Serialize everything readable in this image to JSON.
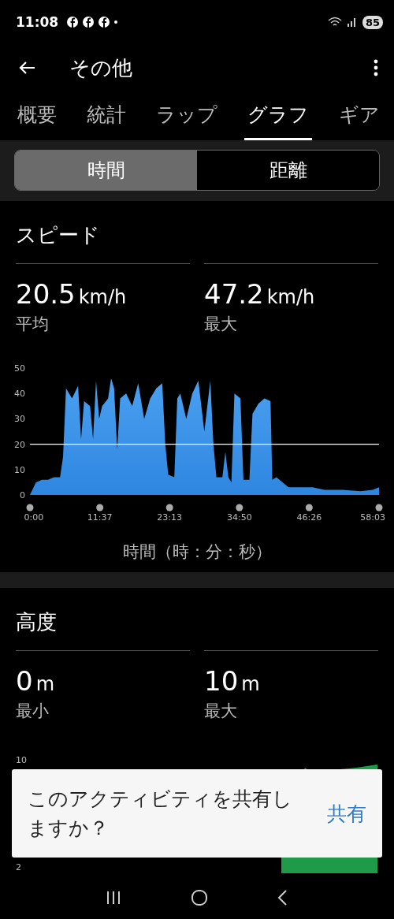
{
  "status_bar": {
    "time": "11:08",
    "battery": "85"
  },
  "app_bar": {
    "title": "その他"
  },
  "tabs": [
    {
      "label": "概要",
      "selected": false
    },
    {
      "label": "統計",
      "selected": false
    },
    {
      "label": "ラップ",
      "selected": false
    },
    {
      "label": "グラフ",
      "selected": true
    },
    {
      "label": "ギア",
      "selected": false
    }
  ],
  "segments": [
    {
      "label": "時間",
      "selected": true
    },
    {
      "label": "距離",
      "selected": false
    }
  ],
  "speed": {
    "title": "スピード",
    "stats": [
      {
        "value": "20.5",
        "unit": "km/h",
        "label": "平均"
      },
      {
        "value": "47.2",
        "unit": "km/h",
        "label": "最大"
      }
    ],
    "chart_data": {
      "type": "area",
      "xlabel": "時間（時：分：秒）",
      "ylim": [
        0,
        50
      ],
      "yticks": [
        0,
        10,
        20,
        30,
        40,
        50
      ],
      "xlim": [
        0,
        58.05
      ],
      "xticks": [
        {
          "value": 0,
          "label": "0:00"
        },
        {
          "value": 11.62,
          "label": "11:37"
        },
        {
          "value": 23.22,
          "label": "23:13"
        },
        {
          "value": 34.83,
          "label": "34:50"
        },
        {
          "value": 46.43,
          "label": "46:26"
        },
        {
          "value": 58.05,
          "label": "58:03"
        }
      ],
      "x": [
        0,
        1,
        2,
        3,
        4,
        5,
        5.5,
        6,
        7,
        8,
        8.5,
        9,
        10,
        10.5,
        11,
        11.5,
        12,
        13,
        13.5,
        14,
        14.5,
        15,
        16,
        17,
        18,
        19,
        20,
        21,
        22,
        22.5,
        23,
        24,
        24.5,
        25,
        26,
        27,
        28,
        29,
        30,
        30.5,
        31,
        32,
        32.5,
        33,
        33.5,
        34,
        35,
        35.5,
        36.5,
        37,
        38,
        39,
        40,
        40.3,
        41,
        42,
        43,
        45,
        47,
        49,
        52,
        55,
        57,
        58.05
      ],
      "series": [
        {
          "color": "#2f86e0",
          "values": [
            0,
            5,
            6,
            6,
            7,
            7,
            15,
            42,
            38,
            43,
            22,
            37,
            35,
            22,
            45,
            30,
            35,
            38,
            46,
            42,
            18,
            38,
            40,
            35,
            44,
            30,
            38,
            42,
            44,
            20,
            8,
            7,
            38,
            40,
            30,
            40,
            45,
            25,
            45,
            20,
            7,
            7,
            17,
            7,
            5,
            40,
            38,
            6,
            6,
            32,
            36,
            38,
            37,
            6,
            7,
            5,
            3,
            3,
            3,
            2,
            2,
            1.5,
            2,
            3
          ]
        }
      ]
    }
  },
  "altitude": {
    "title": "高度",
    "stats": [
      {
        "value": "0",
        "unit": "m",
        "label": "最小"
      },
      {
        "value": "10",
        "unit": "m",
        "label": "最大"
      }
    ],
    "axis_labels": [
      "10",
      "2"
    ]
  },
  "toast": {
    "message": "このアクティビティを共有しますか？",
    "action": "共有"
  }
}
